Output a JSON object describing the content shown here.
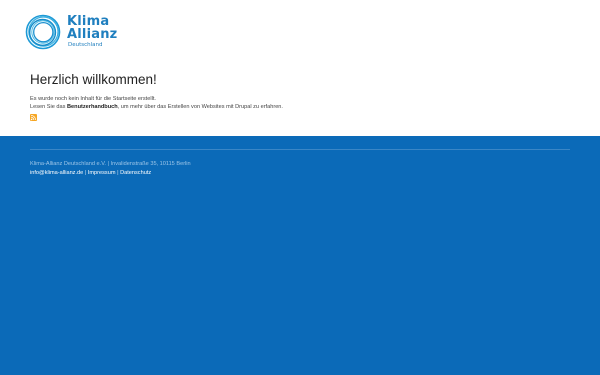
{
  "brand": {
    "line1": "Klima",
    "line2": "Allianz",
    "line3": "Deutschland",
    "color": "#1f7fbf",
    "icon": "circle-swirl-logo"
  },
  "main": {
    "title": "Herzlich willkommen!",
    "line1": "Es wurde noch kein Inhalt für die Startseite erstellt.",
    "line2_prefix": "Lesen Sie das",
    "line2_link": "Benutzerhandbuch",
    "line2_suffix": ", um mehr über das Erstellen von Websites mit Drupal zu erfahren.",
    "feed_icon": "rss-feed-icon"
  },
  "footer": {
    "background": "#0b6ab8",
    "address": "Klima-Allianz Deutschland e.V. | Invalidenstraße 35, 10115 Berlin",
    "email": "info@klima-allianz.de",
    "impressum": "Impressum",
    "datenschutz": "Datenschutz",
    "separator": "|"
  }
}
